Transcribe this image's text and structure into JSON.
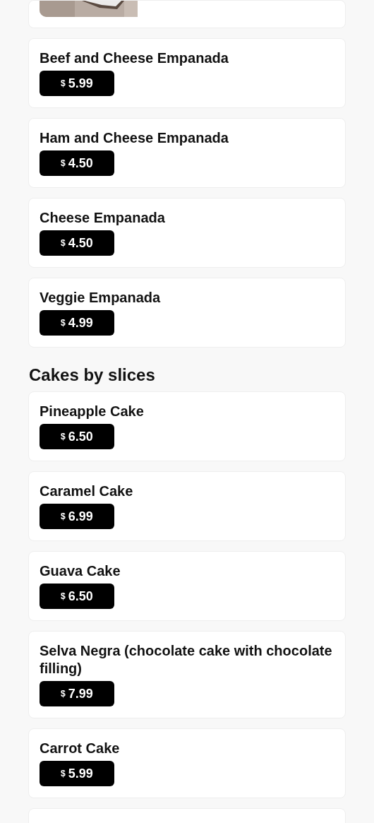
{
  "sections": [
    {
      "items": [
        {
          "kind": "picture"
        },
        {
          "kind": "product",
          "name": "Beef and Cheese Empanada",
          "currency": "$",
          "price": "5.99"
        },
        {
          "kind": "product",
          "name": "Ham and Cheese Empanada",
          "currency": "$",
          "price": "4.50"
        },
        {
          "kind": "product",
          "name": "Cheese Empanada",
          "currency": "$",
          "price": "4.50"
        },
        {
          "kind": "product",
          "name": "Veggie Empanada",
          "currency": "$",
          "price": "4.99"
        }
      ]
    },
    {
      "title": "Cakes by slices",
      "items": [
        {
          "kind": "product",
          "name": "Pineapple Cake",
          "currency": "$",
          "price": "6.50"
        },
        {
          "kind": "product",
          "name": "Caramel Cake",
          "currency": "$",
          "price": "6.99"
        },
        {
          "kind": "product",
          "name": "Guava Cake",
          "currency": "$",
          "price": "6.50"
        },
        {
          "kind": "product",
          "name": "Selva Negra (chocolate cake with chocolate filling)",
          "currency": "$",
          "price": "7.99"
        },
        {
          "kind": "product",
          "name": "Carrot Cake",
          "currency": "$",
          "price": "5.99"
        },
        {
          "kind": "cut"
        }
      ]
    }
  ]
}
